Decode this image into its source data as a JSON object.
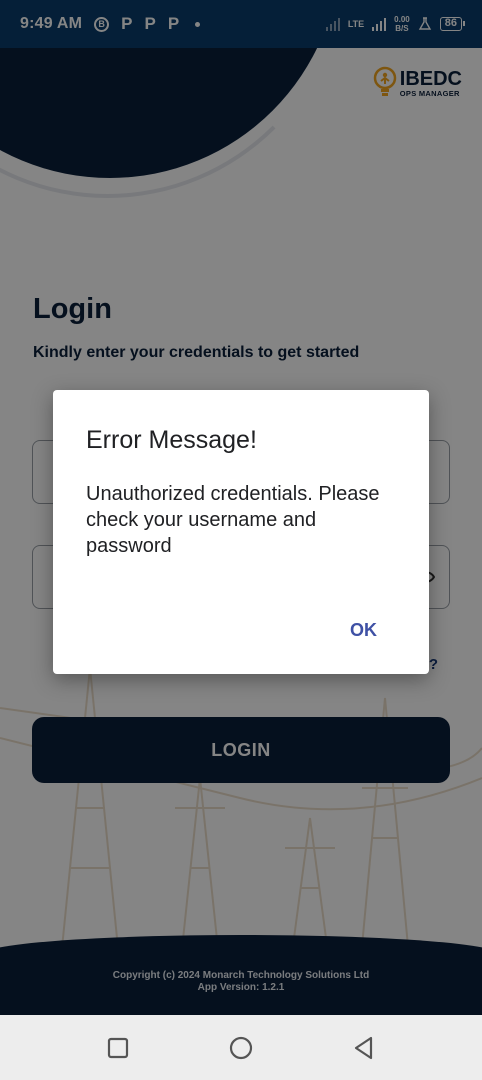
{
  "status_bar": {
    "time": "9:49 AM",
    "left_icons": [
      "b-circle-icon",
      "p-icon",
      "p-icon",
      "p-icon",
      "dot-icon"
    ],
    "network_type": "LTE",
    "speed_value": "0.00",
    "speed_unit": "B/S",
    "battery": "86"
  },
  "app": {
    "logo_text": "IBEDC",
    "logo_subtext": "OPS MANAGER",
    "login_title": "Login",
    "login_subtitle": "Kindly enter your credentials to get started",
    "forgot_partial": "?",
    "login_button": "LOGIN",
    "footer_copyright": "Copyright (c) 2024 Monarch Technology Solutions Ltd",
    "footer_version": "App Version: 1.2.1"
  },
  "dialog": {
    "title": "Error Message!",
    "body": "Unauthorized credentials. Please check your username and password",
    "ok_label": "OK"
  },
  "colors": {
    "status_bar": "#0a3d6b",
    "brand_navy": "#0b1f3a",
    "dialog_button": "#3f51a5",
    "logo_accent": "#f2a51f"
  },
  "nav": {
    "icons": [
      "recents-square-icon",
      "home-circle-icon",
      "back-triangle-icon"
    ]
  }
}
